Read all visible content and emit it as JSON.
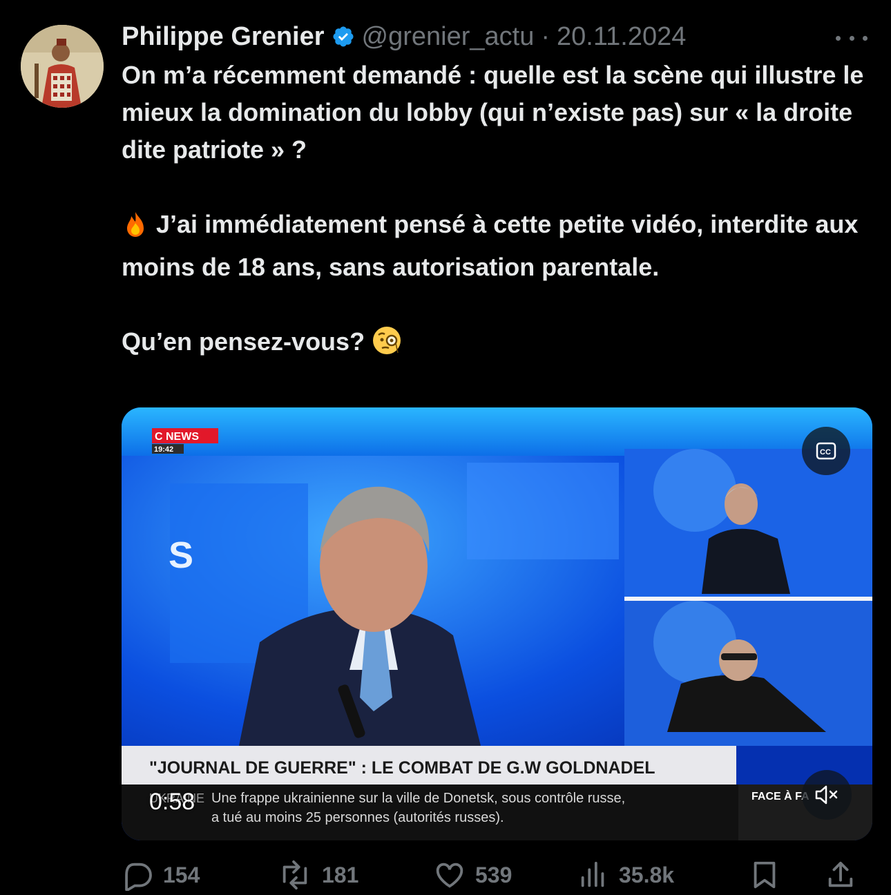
{
  "tweet": {
    "author_name": "Philippe Grenier",
    "handle": "@grenier_actu",
    "separator": "·",
    "date": "20.11.2024",
    "text_lines": [
      "On m’a récemment demandé : quelle est la scène qui illustre le mieux la domination du lobby (qui n’existe pas) sur « la droite dite patriote » ?",
      "J’ai immédiatement pensé à cette petite vidéo, interdite aux moins de 18 ans, sans autorisation parentale.",
      "Qu’en pensez-vous?"
    ]
  },
  "video": {
    "channel_logo": "C NEWS",
    "clock": "19:42",
    "studio_label_left": "S",
    "banner_title": "\"JOURNAL DE GUERRE\" : LE COMBAT DE G.W GOLDNADEL",
    "ticker_prefix": "UKRAINE",
    "ticker_line1": "Une frappe ukrainienne sur la ville de Donetsk, sous contrôle russe,",
    "ticker_line2": "a tué au moins 25 personnes (autorités russes).",
    "show_logo": "FACE À FA",
    "duration": "0:58",
    "cc_label": "CC"
  },
  "actions": {
    "replies": "154",
    "reposts": "181",
    "likes": "539",
    "views": "35.8k"
  },
  "colors": {
    "background": "#000000",
    "text": "#e7e9ea",
    "secondary": "#71767b",
    "verified": "#1d9bf0",
    "fire": "#ff6a00",
    "banner": "#e8e8ec"
  },
  "icons": [
    "verified-badge-icon",
    "more-icon",
    "fire-emoji-icon",
    "monocle-face-emoji-icon",
    "cc-icon",
    "mute-icon",
    "reply-icon",
    "repost-icon",
    "like-icon",
    "views-icon",
    "bookmark-icon",
    "share-icon"
  ]
}
